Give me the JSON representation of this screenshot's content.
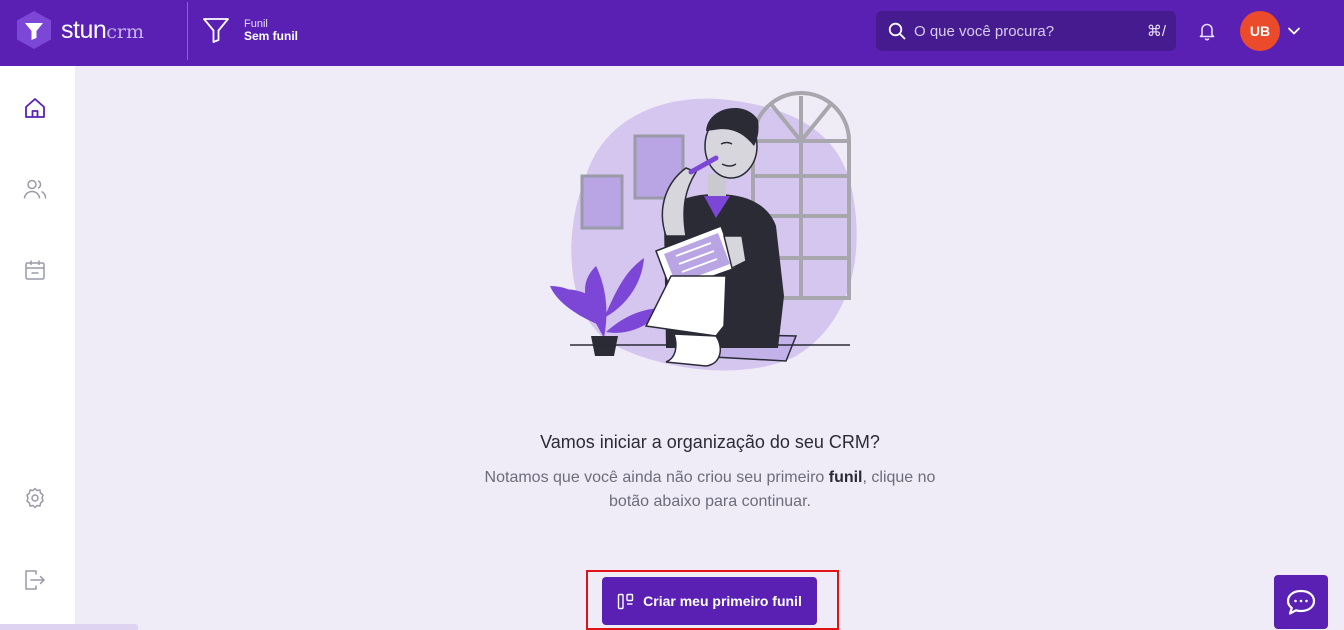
{
  "header": {
    "logo": {
      "name": "stun",
      "suffix": "crm"
    },
    "funnel": {
      "label": "Funil",
      "value": "Sem funil"
    },
    "search": {
      "placeholder": "O que você procura?",
      "shortcut": "⌘/"
    },
    "user": {
      "initials": "UB"
    }
  },
  "sidebar": {
    "items": [
      {
        "icon": "home-icon",
        "active": true
      },
      {
        "icon": "users-icon",
        "active": false
      },
      {
        "icon": "calendar-icon",
        "active": false
      },
      {
        "icon": "gear-icon",
        "active": false
      },
      {
        "icon": "logout-icon",
        "active": false
      }
    ]
  },
  "empty_state": {
    "title": "Vamos iniciar a organização do seu CRM?",
    "desc_before": "Notamos que você ainda não criou seu primeiro ",
    "desc_bold": "funil",
    "desc_after": ", clique no botão abaixo para continuar.",
    "cta_label": "Criar meu primeiro funil"
  },
  "colors": {
    "brand": "#5a20b3",
    "avatar": "#eb4b2a",
    "highlight": "#e01414",
    "background": "#efecf7"
  }
}
